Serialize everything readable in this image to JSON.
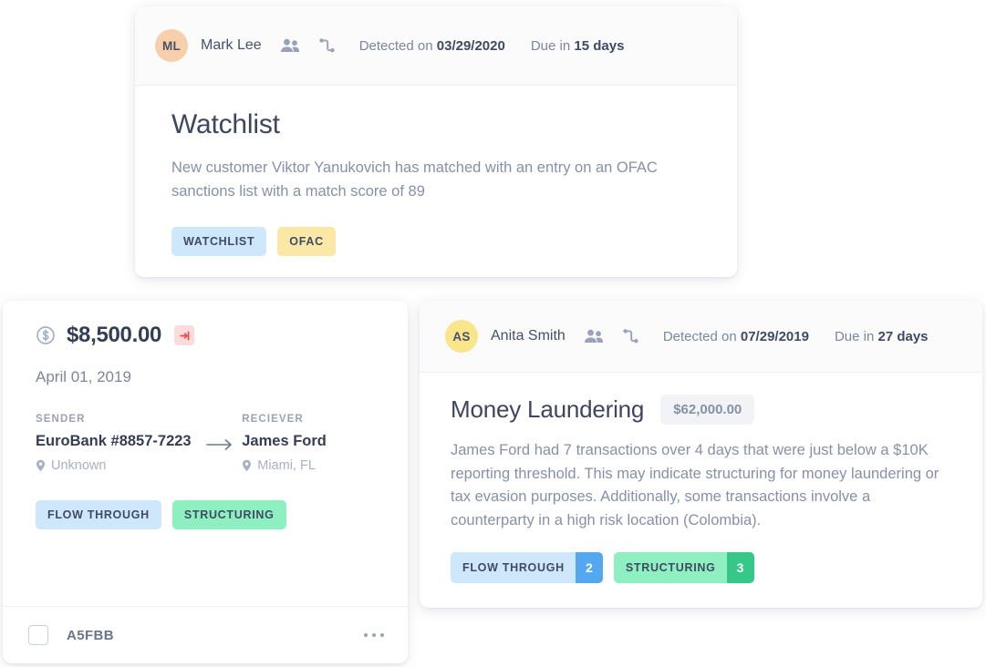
{
  "colors": {
    "avatar_peach": "#f8cfab",
    "avatar_yellow": "#f9e58a",
    "tag_blue": "#cfe7fb",
    "tag_yellow": "#fbe8a6",
    "tag_green": "#8ef0c0",
    "count_blue": "#54a8ef",
    "count_green": "#35c888",
    "flag_red": "#f0494a",
    "text_dark": "#353e54",
    "text_muted": "#8790a6"
  },
  "watchlist_card": {
    "header": {
      "avatar_initials": "ML",
      "avatar_icon": "avatar",
      "person_name": "Mark Lee",
      "people_icon": "people-icon",
      "flow_icon": "flow-graph-icon",
      "detected_prefix": "Detected on ",
      "detected_date": "03/29/2020",
      "due_prefix": "Due in ",
      "due_value": "15 days"
    },
    "title": "Watchlist",
    "description": "New customer Viktor Yanukovich has matched with an entry on an OFAC sanctions list with a match score of 89",
    "tags": [
      {
        "label": "WATCHLIST",
        "color": "blue"
      },
      {
        "label": "OFAC",
        "color": "yellow"
      }
    ]
  },
  "transaction_card": {
    "coin_icon": "dollar-coin-icon",
    "amount": "$8,500.00",
    "flag_icon": "outgoing-transfer-icon",
    "date": "April 01, 2019",
    "sender": {
      "label": "SENDER",
      "name": "EuroBank #8857-7223",
      "location_icon": "location-pin-icon",
      "location": "Unknown"
    },
    "arrow_icon": "arrow-right-icon",
    "receiver": {
      "label": "RECIEVER",
      "name": "James Ford",
      "location_icon": "location-pin-icon",
      "location": "Miami, FL"
    },
    "tags": [
      {
        "label": "FLOW THROUGH",
        "color": "blue"
      },
      {
        "label": "STRUCTURING",
        "color": "green"
      }
    ],
    "footer": {
      "checkbox_icon": "checkbox-unchecked",
      "code": "A5FBB",
      "more_icon": "more-options-icon"
    }
  },
  "alert_card": {
    "header": {
      "avatar_initials": "AS",
      "avatar_icon": "avatar",
      "person_name": "Anita Smith",
      "people_icon": "people-icon",
      "flow_icon": "flow-graph-icon",
      "detected_prefix": "Detected on ",
      "detected_date": "07/29/2019",
      "due_prefix": "Due in ",
      "due_value": "27 days"
    },
    "title": "Money Laundering",
    "amount_pill": "$62,000.00",
    "description": "James Ford had 7 transactions over 4 days that were just below a $10K reporting threshold. This may indicate structuring for money laundering or tax evasion purposes. Additionally, some transactions involve a counterparty in a high risk location (Colombia).",
    "tags": [
      {
        "label": "FLOW THROUGH",
        "color": "blue",
        "count": "2"
      },
      {
        "label": "STRUCTURING",
        "color": "green",
        "count": "3"
      }
    ]
  }
}
